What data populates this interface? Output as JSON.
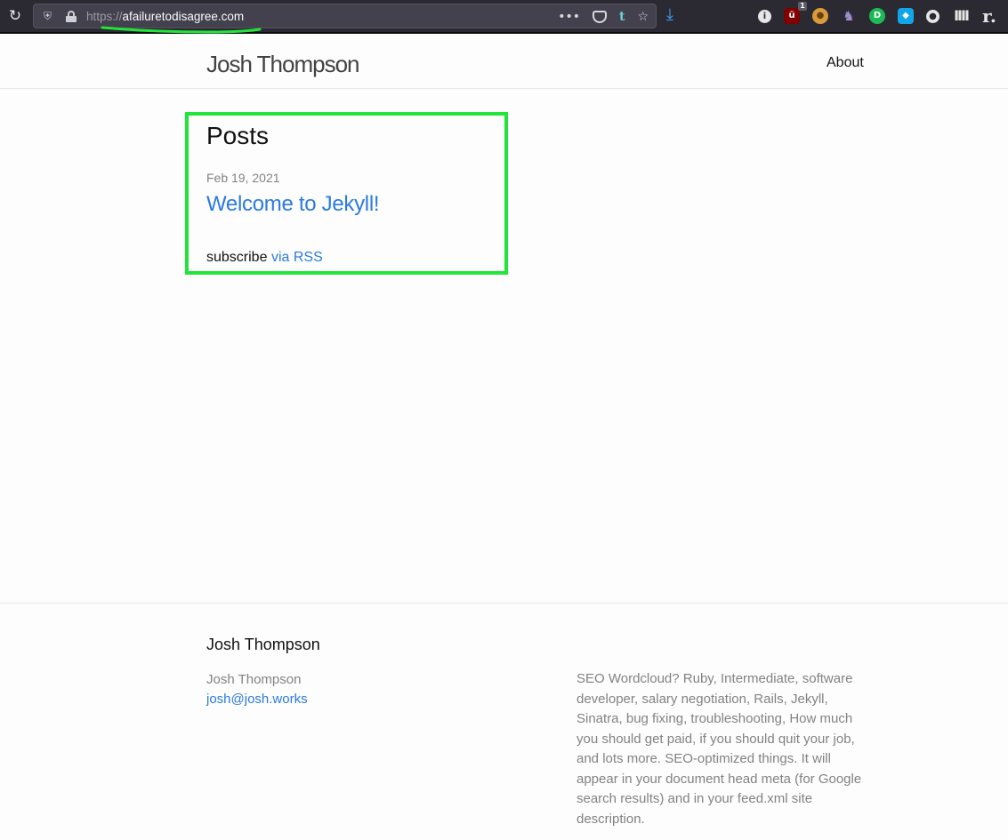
{
  "browser": {
    "url_scheme": "https://",
    "url_host": "afailuretodisagree.com",
    "more_glyph": "•••",
    "tumblr_glyph": "t",
    "star_glyph": "☆",
    "download_glyph": "⤓",
    "reload_glyph": "↻",
    "extensions": [
      {
        "name": "info-icon",
        "glyph": "i"
      },
      {
        "name": "ublock-icon",
        "glyph": "ū",
        "badge": "1"
      },
      {
        "name": "cookie-icon",
        "glyph": "●"
      },
      {
        "name": "fox-icon",
        "glyph": "♞"
      },
      {
        "name": "green-extension-icon",
        "glyph": "D"
      },
      {
        "name": "cube-icon",
        "glyph": "◆"
      },
      {
        "name": "account-icon",
        "glyph": "●"
      },
      {
        "name": "bars-icon",
        "glyph": "IIII"
      },
      {
        "name": "readwise-icon",
        "glyph": "r."
      }
    ]
  },
  "header": {
    "site_title": "Josh Thompson",
    "nav": [
      {
        "label": "About"
      }
    ]
  },
  "main": {
    "heading": "Posts",
    "posts": [
      {
        "date": "Feb 19, 2021",
        "title": "Welcome to Jekyll!"
      }
    ],
    "subscribe_text": "subscribe",
    "subscribe_link": "via RSS"
  },
  "footer": {
    "heading": "Josh Thompson",
    "name": "Josh Thompson",
    "email": "josh@josh.works",
    "description": "SEO Wordcloud? Ruby, Intermediate, software developer, salary negotiation, Rails, Jekyll, Sinatra, bug fixing, troubleshooting, How much you should get paid, if you should quit your job, and lots more. SEO-optimized things. It will appear in your document head meta (for Google search results) and in your feed.xml site description."
  },
  "colors": {
    "annotation_green": "#22e53a",
    "link_blue": "#2a7ae2",
    "toolbar_bg": "#2b2a33"
  }
}
